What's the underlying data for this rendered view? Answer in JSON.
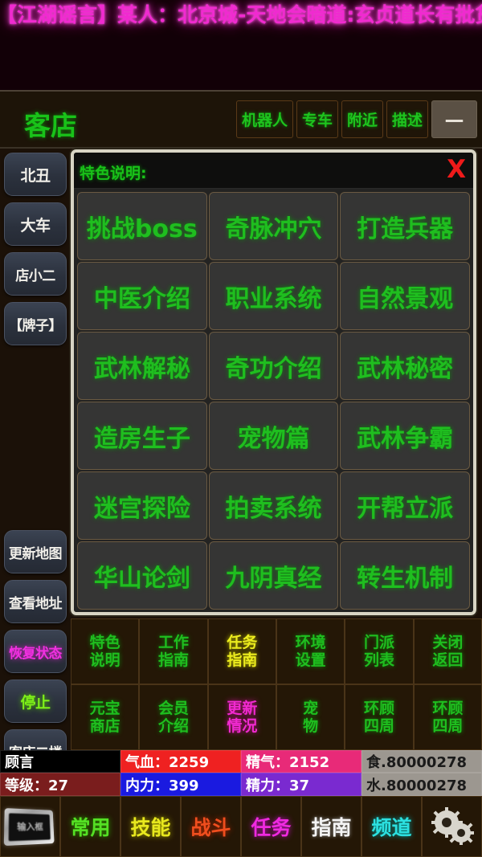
{
  "marquee": {
    "text": "【江湖谣言】某人：北京城-天地会暗道:玄贞道长有批货物要送到",
    "color": "#f02ad0"
  },
  "header": {
    "title": "客店",
    "title_color": "#19c219",
    "buttons": [
      {
        "label": "机器人"
      },
      {
        "label": "专车"
      },
      {
        "label": "附近"
      },
      {
        "label": "描述"
      }
    ],
    "minimize_label": "—"
  },
  "sidebar": {
    "items": [
      {
        "label": "北丑",
        "color": "white"
      },
      {
        "label": "大车",
        "color": "white"
      },
      {
        "label": "店小二",
        "color": "white"
      },
      {
        "label": "【牌子】",
        "color": "white"
      },
      {
        "label": "更新地图",
        "color": "white"
      },
      {
        "label": "查看地址",
        "color": "white"
      },
      {
        "label": "恢复状态",
        "color": "pink"
      },
      {
        "label": "停止",
        "color": "green"
      },
      {
        "label": "客店二楼",
        "color": "white"
      }
    ]
  },
  "modal": {
    "title": "特色说明:",
    "close_label": "X",
    "close_color": "#ef1a1a",
    "cells": [
      "挑战boss",
      "奇脉冲穴",
      "打造兵器",
      "中医介绍",
      "职业系统",
      "自然景观",
      "武林解秘",
      "奇功介绍",
      "武林秘密",
      "造房生子",
      "宠物篇",
      "武林争霸",
      "迷宫探险",
      "拍卖系统",
      "开帮立派",
      "华山论剑",
      "九阴真经",
      "转生机制"
    ]
  },
  "menus": {
    "row1": [
      {
        "line1": "特色",
        "line2": "说明",
        "color": "green"
      },
      {
        "line1": "工作",
        "line2": "指南",
        "color": "green"
      },
      {
        "line1": "任务",
        "line2": "指南",
        "color": "yellow"
      },
      {
        "line1": "环境",
        "line2": "设置",
        "color": "green"
      },
      {
        "line1": "门派",
        "line2": "列表",
        "color": "green"
      },
      {
        "line1": "关闭",
        "line2": "返回",
        "color": "green"
      }
    ],
    "row2": [
      {
        "line1": "元宝",
        "line2": "商店",
        "color": "green"
      },
      {
        "line1": "会员",
        "line2": "介绍",
        "color": "green"
      },
      {
        "line1": "更新",
        "line2": "情况",
        "color": "pink"
      },
      {
        "line1": "宠",
        "line2": "物",
        "color": "green"
      },
      {
        "line1": "环顾",
        "line2": "四周",
        "color": "green"
      },
      {
        "line1": "环顾",
        "line2": "四周",
        "color": "green"
      }
    ]
  },
  "status": {
    "name": "顾言",
    "hp": "气血：2259",
    "jing": "精气：2152",
    "food": "食.80000278",
    "level": "等级：27",
    "mp": "内力：399",
    "stamina": "精力：37",
    "water": "水.80000278"
  },
  "bottomnav": {
    "input_icon_label": "输入框",
    "items": [
      {
        "label": "常用",
        "color": "green"
      },
      {
        "label": "技能",
        "color": "yellow"
      },
      {
        "label": "战斗",
        "color": "orange"
      },
      {
        "label": "任务",
        "color": "pink"
      },
      {
        "label": "指南",
        "color": "white"
      },
      {
        "label": "频道",
        "color": "cyan"
      }
    ],
    "settings_icon": "gears-icon"
  }
}
